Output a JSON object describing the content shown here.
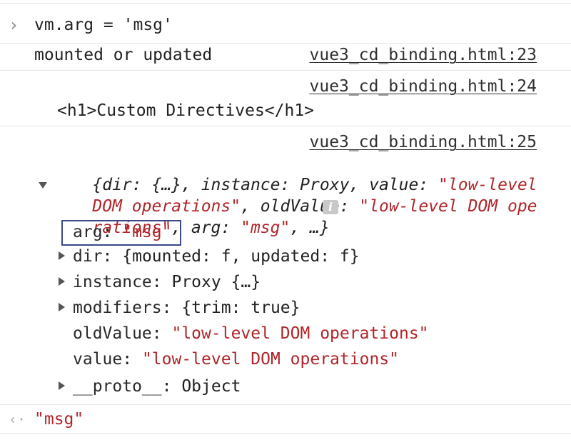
{
  "console": {
    "prompt_marker": "›",
    "input_command": "vm.arg = 'msg'",
    "log1": {
      "text": "mounted or updated",
      "source": "vue3_cd_binding.html:23"
    },
    "log2": {
      "source": "vue3_cd_binding.html:24",
      "element": "<h1>Custom Directives</h1>"
    },
    "log3": {
      "source": "vue3_cd_binding.html:25",
      "preview": {
        "p1": "{dir: {…}, instance: Proxy, value: ",
        "p1_str": "\"low-level",
        "p2_str": "DOM operations\"",
        "p2": ", oldValue: ",
        "p2_str2": "\"low-level DOM ope",
        "p3_str": "rations\"",
        "p3": ", arg: ",
        "p3_str2": "\"msg\"",
        "p3_end": ", …}",
        "info_icon": "i"
      },
      "properties": [
        {
          "key": "arg",
          "value": "\"msg\"",
          "value_type": "string",
          "expandable": false,
          "highlighted": true
        },
        {
          "key": "dir",
          "value": "{mounted: f, updated: f}",
          "value_type": "object",
          "expandable": true
        },
        {
          "key": "instance",
          "value": "Proxy {…}",
          "value_type": "object",
          "expandable": true
        },
        {
          "key": "modifiers",
          "value": "{trim: true}",
          "value_type": "object",
          "expandable": true
        },
        {
          "key": "oldValue",
          "value": "\"low-level DOM operations\"",
          "value_type": "string",
          "expandable": false
        },
        {
          "key": "value",
          "value": "\"low-level DOM operations\"",
          "value_type": "string",
          "expandable": false
        },
        {
          "key": "__proto__",
          "value": "Object",
          "value_type": "object",
          "expandable": true
        }
      ]
    },
    "result_marker": "‹·",
    "result_value": "\"msg\""
  },
  "colors": {
    "string": "#b0262a",
    "highlight_box": "#3a4a8a",
    "divider": "#e6e6e6"
  }
}
